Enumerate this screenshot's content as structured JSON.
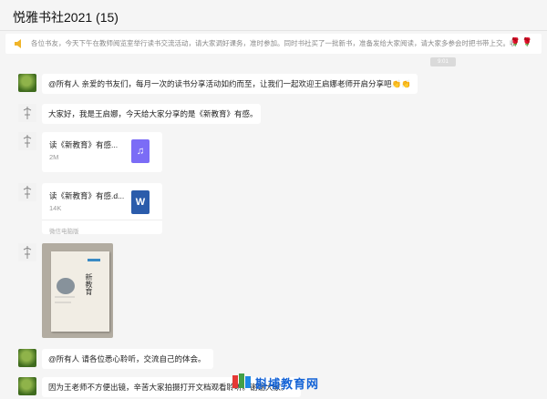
{
  "header": {
    "title": "悦雅书社2021 (15)"
  },
  "notice": {
    "text": "各位书友，今天下午在教师阅览室举行读书交流活动，请大家调好课务，准时参加。同时书社买了一批新书，准备发给大家阅读，请大家多参会时把书带上交。收到请回复。",
    "icon": "speaker-icon",
    "trailing": "🌹🌹"
  },
  "time_divider": "9:01",
  "messages": [
    {
      "type": "text",
      "text": "@所有人 亲爱的书友们，每月一次的读书分享活动如约而至，让我们一起欢迎王启娜老师开启分享吧👏👏"
    },
    {
      "type": "text",
      "text": "大家好，我是王启娜，今天给大家分享的是《新教育》有感。"
    },
    {
      "type": "file",
      "name": "读《新教育》有感...",
      "size": "2M",
      "icon": "audio-file-icon"
    },
    {
      "type": "file",
      "name": "读《新教育》有感.d...",
      "size": "14K",
      "source": "微信电脑版",
      "icon": "word-file-icon",
      "icon_letter": "W"
    },
    {
      "type": "image",
      "book_title": "新教育"
    },
    {
      "type": "text",
      "text": "@所有人 请各位悉心聆听，交流自己的体会。"
    },
    {
      "type": "text",
      "text": "因为王老师不方便出镜，辛苦大家拍摄打开文档观看聆听。谢谢大家。"
    }
  ],
  "watermark": {
    "text": "斟埔教育网"
  },
  "colors": {
    "accent": "#1463d6",
    "audio": "#7b6cf6",
    "word": "#2b5cab"
  }
}
